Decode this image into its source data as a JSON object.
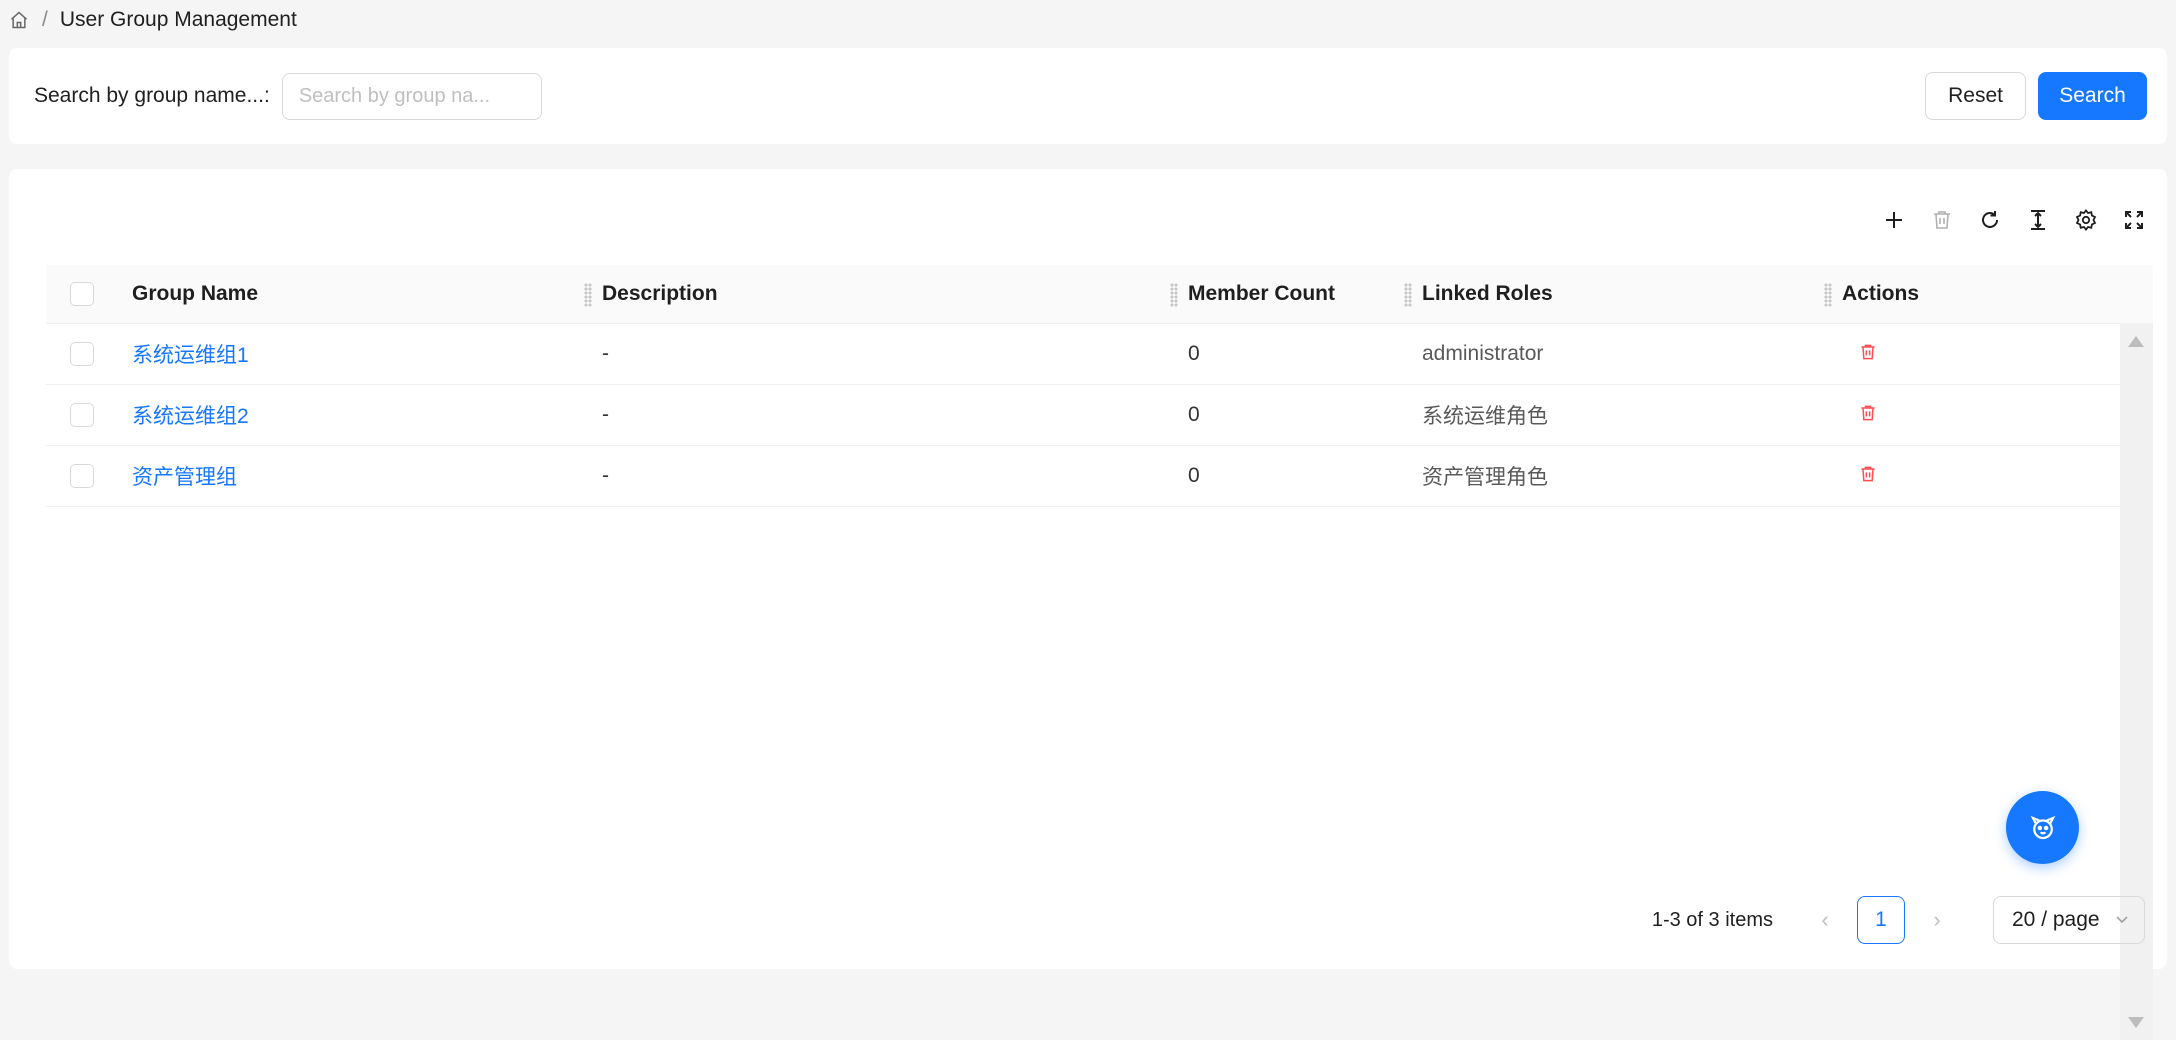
{
  "breadcrumb": {
    "home_icon": "home-icon",
    "separator": "/",
    "current": "User Group Management"
  },
  "search": {
    "label": "Search by group name...:",
    "placeholder": "Search by group na...",
    "value": "",
    "reset_label": "Reset",
    "search_label": "Search"
  },
  "toolbar": {
    "icons": [
      "plus-icon",
      "trash-icon",
      "reload-icon",
      "column-height-icon",
      "gear-icon",
      "fullscreen-icon"
    ]
  },
  "table": {
    "headers": {
      "group_name": "Group Name",
      "description": "Description",
      "member_count": "Member Count",
      "linked_roles": "Linked Roles",
      "actions": "Actions"
    },
    "rows": [
      {
        "group_name": "系统运维组1",
        "description": "-",
        "member_count": "0",
        "linked_roles": "administrator"
      },
      {
        "group_name": "系统运维组2",
        "description": "-",
        "member_count": "0",
        "linked_roles": "系统运维角色"
      },
      {
        "group_name": "资产管理组",
        "description": "-",
        "member_count": "0",
        "linked_roles": "资产管理角色"
      }
    ]
  },
  "pagination": {
    "total_text": "1-3 of 3 items",
    "prev": "‹",
    "current_page": "1",
    "next": "›",
    "page_size": "20 / page"
  },
  "colors": {
    "primary": "#1677ff",
    "danger": "#ff4d4f"
  }
}
